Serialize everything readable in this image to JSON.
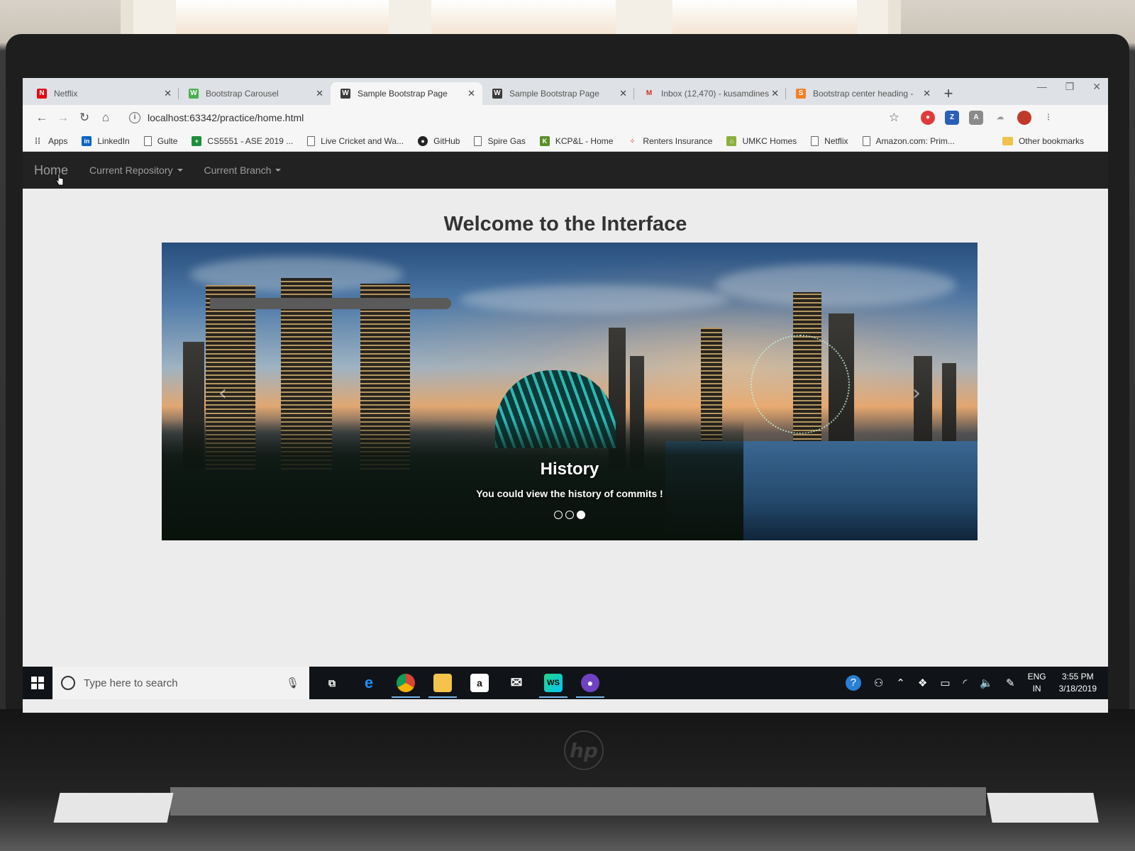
{
  "browser": {
    "tabs": [
      {
        "label": "Netflix",
        "icon": "netflix-icon",
        "color": "#e50914",
        "active": false
      },
      {
        "label": "Bootstrap Carousel",
        "icon": "w3schools-icon",
        "color": "#4caf50",
        "active": false
      },
      {
        "label": "Sample Bootstrap Page",
        "icon": "webstorm-icon",
        "color": "#3a3a3a",
        "active": true
      },
      {
        "label": "Sample Bootstrap Page",
        "icon": "webstorm-icon",
        "color": "#3a3a3a",
        "active": false
      },
      {
        "label": "Inbox (12,470) - kusamdines",
        "icon": "gmail-icon",
        "color": "#d93025",
        "active": false
      },
      {
        "label": "Bootstrap center heading -",
        "icon": "stackoverflow-icon",
        "color": "#f48024",
        "active": false
      }
    ],
    "url": "localhost:63342/practice/home.html",
    "bookmarks": [
      {
        "label": "Apps",
        "icon": "apps-grid-icon"
      },
      {
        "label": "LinkedIn",
        "icon": "linkedin-icon"
      },
      {
        "label": "Gulte",
        "icon": "page-icon"
      },
      {
        "label": "CS5551 - ASE 2019 ...",
        "icon": "sheets-icon"
      },
      {
        "label": "Live Cricket and Wa...",
        "icon": "page-icon"
      },
      {
        "label": "GitHub",
        "icon": "github-icon"
      },
      {
        "label": "Spire Gas",
        "icon": "page-icon"
      },
      {
        "label": "KCP&L - Home",
        "icon": "kcpl-icon"
      },
      {
        "label": "Renters Insurance",
        "icon": "insurance-icon"
      },
      {
        "label": "UMKC Homes",
        "icon": "home-icon"
      },
      {
        "label": "Netflix",
        "icon": "page-icon"
      },
      {
        "label": "Amazon.com: Prim...",
        "icon": "page-icon"
      }
    ],
    "other_bookmarks": "Other bookmarks"
  },
  "navbar": {
    "brand": "Home",
    "items": [
      {
        "label": "Current Repository"
      },
      {
        "label": "Current Branch"
      }
    ]
  },
  "page": {
    "heading": "Welcome to the Interface",
    "carousel": {
      "caption_title": "History",
      "caption_text": "You could view the history of commits !",
      "slide_count": 3,
      "active_slide": 3
    }
  },
  "taskbar": {
    "search_placeholder": "Type here to search",
    "apps": [
      "task-view-icon",
      "edge-icon",
      "chrome-icon",
      "file-explorer-icon",
      "amazon-icon",
      "mail-icon",
      "webstorm-icon",
      "github-desktop-icon"
    ],
    "lang_top": "ENG",
    "lang_bottom": "IN",
    "time": "3:55 PM",
    "date": "3/18/2019"
  }
}
